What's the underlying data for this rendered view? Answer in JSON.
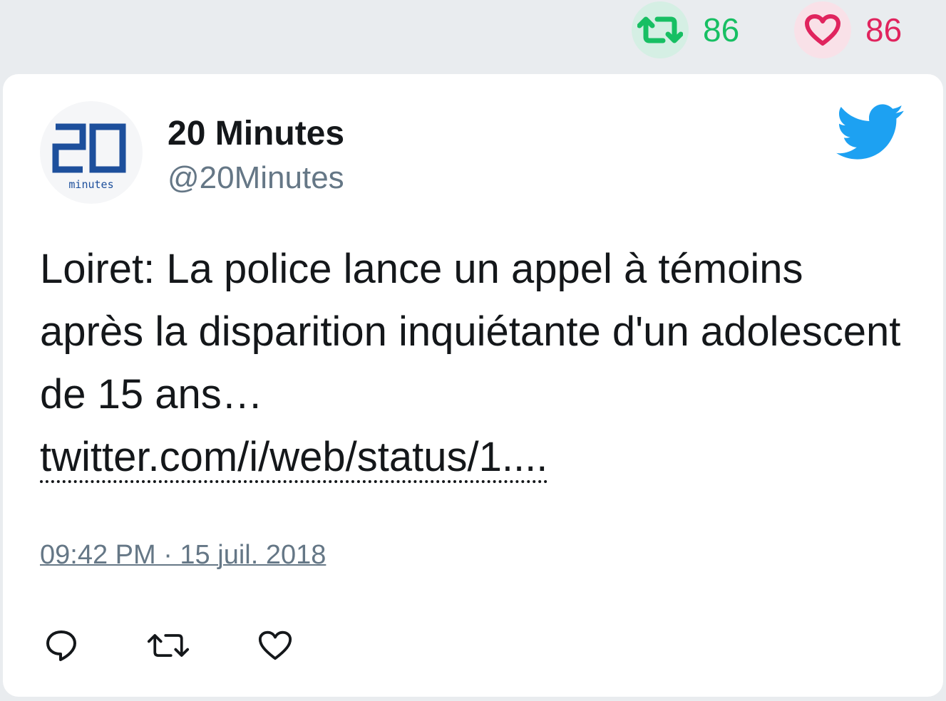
{
  "stats": {
    "retweet_count": "86",
    "like_count": "86"
  },
  "tweet": {
    "author_name": "20 Minutes",
    "author_handle": "@20Minutes",
    "avatar_text_big": "20",
    "avatar_text_small": "minutes",
    "text": "Loiret: La police lance un appel à témoins après la disparition inquiétante d'un adolescent de 15 ans…",
    "link": "twitter.com/i/web/status/1....",
    "timestamp": "09:42 PM · 15 juil. 2018"
  },
  "icons": {
    "retweet": "retweet-icon",
    "like": "heart-icon",
    "reply": "reply-icon",
    "brand": "twitter-bird-icon"
  },
  "colors": {
    "retweet_green": "#17bf63",
    "like_red": "#e0245e",
    "twitter_blue": "#1da1f2",
    "handle_gray": "#657786",
    "avatar_blue": "#1d4f9c"
  }
}
